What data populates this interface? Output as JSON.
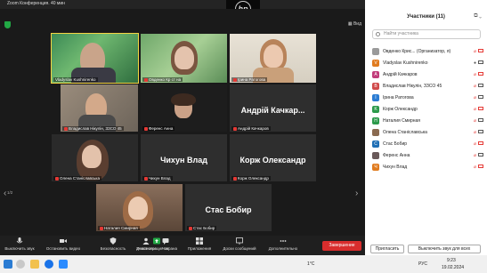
{
  "app": {
    "title": "Zoom Конференция. 40 мин",
    "view_label": "Вид"
  },
  "tiles": [
    {
      "name": "Vladyslav Kushnirenko",
      "mic_off": false,
      "video": true,
      "active": true
    },
    {
      "name": "Овденко Кр ст на",
      "mic_off": true,
      "video": true
    },
    {
      "name": "Ірина Ратогова",
      "mic_off": true,
      "video": true
    },
    {
      "name": "Владислав Нікулін, ЗЗСО 45",
      "mic_off": true,
      "video": true
    },
    {
      "name": "Ференс Анна",
      "mic_off": true,
      "video": true
    },
    {
      "name": "Андрій Качкаров",
      "big_label": "Андрій Качкар...",
      "mic_off": true,
      "video": false
    },
    {
      "name": "Олена Станіславська",
      "mic_off": true,
      "video": true
    },
    {
      "name": "Чихун Влад",
      "big_label": "Чихун Влад",
      "mic_off": true,
      "video": false
    },
    {
      "name": "Корж Олександр",
      "big_label": "Корж Олександр",
      "mic_off": true,
      "video": false
    },
    {
      "name": "Наталия Смирная",
      "mic_off": true,
      "video": true
    },
    {
      "name": "Стас Бобир",
      "big_label": "Стас Бобир",
      "mic_off": true,
      "video": false
    }
  ],
  "page_indicator": "1/2",
  "toolbar": {
    "mute": "Выключить звук",
    "video": "Остановить видео",
    "security": "Безопасность",
    "participants": "Участники",
    "participants_count": "11",
    "chat": "Чат",
    "share": "Демонстрация экрана",
    "apps": "Приложения",
    "whiteboards": "Доски сообщений",
    "more": "Дополнительно",
    "end": "Завершение"
  },
  "panel": {
    "title": "Участники (11)",
    "search_placeholder": "Найти участника",
    "participants": [
      {
        "initial": "",
        "name": "Овденко Крис... (Организатор, я)",
        "color": "#9a9a9a",
        "muted": true,
        "cam_off": true
      },
      {
        "initial": "V",
        "name": "Vladyslav Kushnirenko",
        "color": "#e07b1f",
        "muted": false,
        "cam_off": false
      },
      {
        "initial": "A",
        "name": "Андрій Качкаров",
        "color": "#c13c7a",
        "muted": true,
        "cam_off": true
      },
      {
        "initial": "B",
        "name": "Владислав Нікулін, ЗЗСО 45",
        "color": "#d04a4a",
        "muted": true,
        "cam_off": false
      },
      {
        "initial": "I",
        "name": "Ірина Ратогова",
        "color": "#2b7cd3",
        "muted": true,
        "cam_off": false
      },
      {
        "initial": "K",
        "name": "Корж Олександр",
        "color": "#2c9a4b",
        "muted": true,
        "cam_off": true
      },
      {
        "initial": "H",
        "name": "Наталия Смирная",
        "color": "#2c9a4b",
        "muted": true,
        "cam_off": false
      },
      {
        "initial": "",
        "name": "Олена Станіславська",
        "color": "#8a6a50",
        "muted": true,
        "cam_off": false
      },
      {
        "initial": "C",
        "name": "Стас Бобир",
        "color": "#1f6fb5",
        "muted": true,
        "cam_off": true
      },
      {
        "initial": "",
        "name": "Ференс Анна",
        "color": "#6a5a5a",
        "muted": true,
        "cam_off": false
      },
      {
        "initial": "Ч",
        "name": "Чихун Влад",
        "color": "#e07b1f",
        "muted": true,
        "cam_off": true
      }
    ],
    "invite_label": "Пригласить",
    "mute_all_label": "Выключить звук для всех"
  },
  "taskbar": {
    "temperature": "1°C",
    "language": "РУС",
    "time": "9:23",
    "date": "19.02.2024"
  }
}
